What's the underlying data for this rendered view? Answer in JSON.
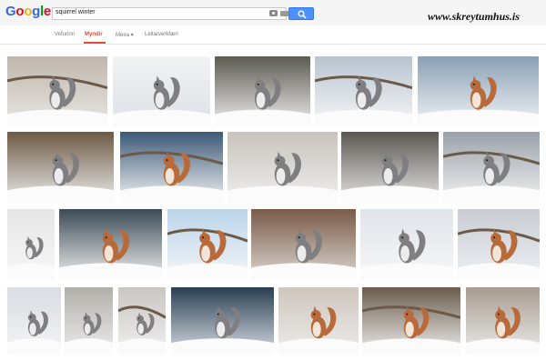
{
  "logo": {
    "letters": [
      "G",
      "o",
      "o",
      "g",
      "l",
      "e"
    ],
    "colors": [
      "#3369e8",
      "#d50f25",
      "#eeb211",
      "#3369e8",
      "#009925",
      "#d50f25"
    ]
  },
  "search": {
    "query": "squirrel winter"
  },
  "watermark": "www.skreytumhus.is",
  "tabs": [
    {
      "label": "Vefurinn",
      "active": false
    },
    {
      "label": "Myndir",
      "active": true
    },
    {
      "label": "Meira ▾",
      "active": false
    },
    {
      "label": "Leitarverkfæri",
      "active": false
    }
  ],
  "colors": {
    "accent_red": "#dd4b39",
    "button_blue": "#4d90fe"
  },
  "images": [
    {
      "squirrel": "gray-squirrel-on-branch",
      "tone": "gray"
    },
    {
      "squirrel": "gray-squirrel-in-snow",
      "tone": "gray"
    },
    {
      "squirrel": "white-squirrel-on-branch",
      "tone": "gray"
    },
    {
      "squirrel": "gray-squirrel-sitting",
      "tone": "gray"
    },
    {
      "squirrel": "red-squirrel-in-snow",
      "tone": "red"
    },
    {
      "squirrel": "gray-squirrel-in-snowy-tree",
      "tone": "gray"
    },
    {
      "squirrel": "red-squirrel-with-pinecone",
      "tone": "red"
    },
    {
      "squirrel": "squirrel-on-snowy-log",
      "tone": "gray"
    },
    {
      "squirrel": "gray-squirrel-fluffy",
      "tone": "gray"
    },
    {
      "squirrel": "gray-squirrel-in-snow",
      "tone": "gray"
    },
    {
      "squirrel": "gray-squirrel-sitting",
      "tone": "gray"
    },
    {
      "squirrel": "red-squirrel-on-snowy-branch",
      "tone": "red"
    },
    {
      "squirrel": "red-squirrel-standing",
      "tone": "red"
    },
    {
      "squirrel": "gray-squirrel-in-woods",
      "tone": "gray"
    },
    {
      "squirrel": "gray-squirrel-in-snow",
      "tone": "gray"
    },
    {
      "squirrel": "red-squirrel-in-snow",
      "tone": "red"
    },
    {
      "squirrel": "gray-squirrel-snowy",
      "tone": "gray"
    },
    {
      "squirrel": "gray-squirrel-on-stump",
      "tone": "gray"
    },
    {
      "squirrel": "gray-squirrel-eating",
      "tone": "gray"
    },
    {
      "squirrel": "gray-squirrel-on-snow",
      "tone": "gray"
    },
    {
      "squirrel": "red-squirrel-in-branches",
      "tone": "red"
    },
    {
      "squirrel": "red-squirrel-on-trunk",
      "tone": "red"
    },
    {
      "squirrel": "red-squirrel-on-trunk",
      "tone": "red"
    }
  ]
}
